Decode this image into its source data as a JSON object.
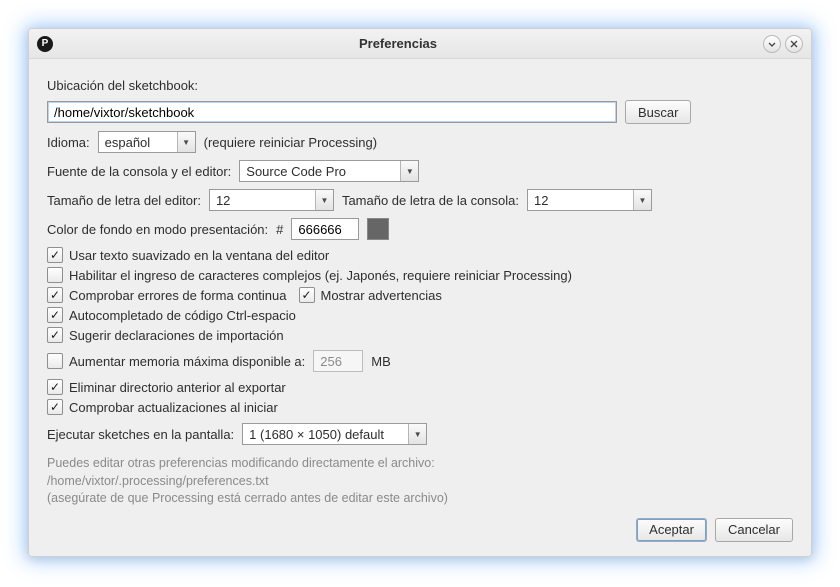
{
  "window": {
    "title": "Preferencias"
  },
  "sketchbook": {
    "label": "Ubicación del sketchbook:",
    "path": "/home/vixtor/sketchbook",
    "browse": "Buscar"
  },
  "language": {
    "label": "Idioma:",
    "value": "español",
    "hint": "(requiere reiniciar Processing)"
  },
  "font": {
    "label": "Fuente de la consola y el editor:",
    "value": "Source Code Pro"
  },
  "editorSize": {
    "label": "Tamaño de letra del editor:",
    "value": "12"
  },
  "consoleSize": {
    "label": "Tamaño de letra de la consola:",
    "value": "12"
  },
  "bgcolor": {
    "label": "Color de fondo en modo presentación:",
    "hash": "#",
    "value": "666666",
    "swatch": "#666666"
  },
  "checks": {
    "smoothText": "Usar texto suavizado en la ventana del editor",
    "complexInput": "Habilitar el ingreso de caracteres complejos (ej. Japonés, requiere reiniciar Processing)",
    "continuousErrors": "Comprobar errores de forma continua",
    "showWarnings": "Mostrar advertencias",
    "autocomplete": "Autocompletado de código Ctrl-espacio",
    "importSuggest": "Sugerir declaraciones de importación",
    "maxMemory": "Aumentar memoria máxima disponible a:",
    "memoryValue": "256",
    "memoryUnit": "MB",
    "deletePrev": "Eliminar directorio anterior al exportar",
    "checkUpdates": "Comprobar actualizaciones al iniciar"
  },
  "display": {
    "label": "Ejecutar sketches en la pantalla:",
    "value": "1 (1680 × 1050) default"
  },
  "footer": {
    "line1": "Puedes editar otras preferencias modificando directamente el archivo:",
    "line2": "/home/vixtor/.processing/preferences.txt",
    "line3": "(asegúrate de que Processing está cerrado antes de editar este archivo)"
  },
  "buttons": {
    "ok": "Aceptar",
    "cancel": "Cancelar"
  }
}
